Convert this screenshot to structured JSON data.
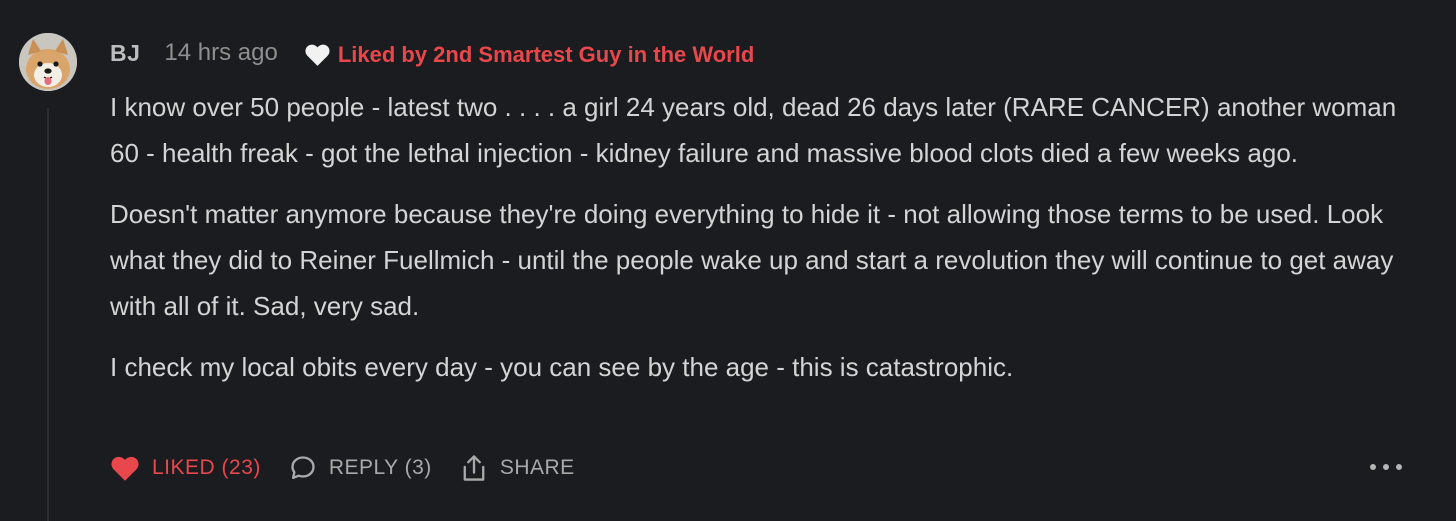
{
  "comment": {
    "author": "BJ",
    "timestamp": "14 hrs ago",
    "liked_by": "Liked by 2nd Smartest Guy in the World",
    "paragraphs": [
      "I know over 50 people - latest two . . . . a girl 24 years old, dead 26 days later (RARE CANCER) another woman 60 - health freak - got the lethal injection - kidney failure and massive blood clots died a few weeks ago.",
      "Doesn't matter anymore because they're doing everything to hide it - not allowing those terms to be used. Look what they did to Reiner Fuellmich - until the people wake up and start a revolution they will continue to get away with all of it. Sad, very sad.",
      "I check my local obits every day - you can see by the age - this is catastrophic."
    ]
  },
  "actions": {
    "like_label": "LIKED (23)",
    "reply_label": "REPLY (3)",
    "share_label": "SHARE"
  },
  "icons": {
    "avatar": "dog-avatar",
    "liked_by": "heart-icon",
    "like": "heart-filled-icon",
    "reply": "speech-bubble-icon",
    "share": "share-icon",
    "more": "more-icon"
  },
  "colors": {
    "background": "#1b1c1f",
    "accent": "#e8474c",
    "text": "#d4d4d4",
    "muted": "#8f8f8f"
  }
}
